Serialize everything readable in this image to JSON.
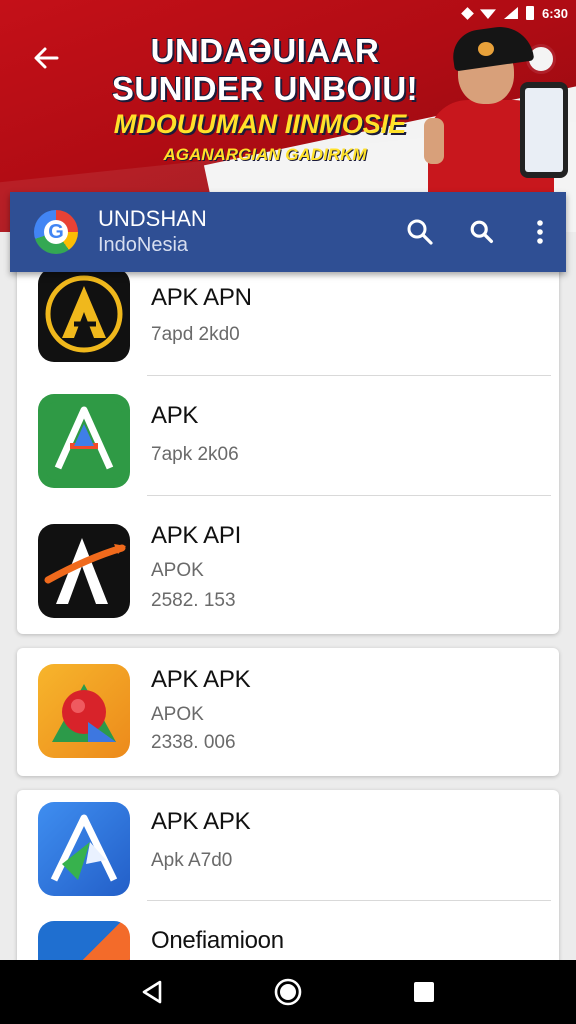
{
  "status_bar": {
    "time": "6:30",
    "icons": [
      "diamond-icon",
      "wifi-icon",
      "signal-icon",
      "battery-icon"
    ]
  },
  "banner": {
    "line1": "UNDAƏUIAAR",
    "line2": "SUNIDER UNBOIU!",
    "line3": "MDOUUMAN IINMOSIE",
    "line4": "AGANARGIAN GADIRKM",
    "back_icon": "arrow-left-icon"
  },
  "app_bar": {
    "title": "UNDSHAN",
    "subtitle": "IndoNesia",
    "icons": [
      "search-icon",
      "search-icon",
      "more-vert-icon"
    ],
    "color": "#2f4f94"
  },
  "apps": [
    {
      "name": "APK APN",
      "meta1": "7apd 2kd0",
      "meta2": "",
      "icon": "apk-a-logo-black"
    },
    {
      "name": "APK",
      "meta1": "7apk 2k06",
      "meta2": "",
      "icon": "apk-a-logo-green"
    },
    {
      "name": "APK API",
      "meta1": "APOK",
      "meta2": "2582. 153",
      "icon": "apk-a-swoosh-black"
    },
    {
      "name": "APK APK",
      "meta1": "APOK",
      "meta2": "2338. 006",
      "icon": "apk-ball-orange"
    },
    {
      "name": "APK APK",
      "meta1": "Apk A7d0",
      "meta2": "",
      "icon": "apk-a-logo-blue"
    },
    {
      "name": "Onefiamioon",
      "meta1": "",
      "meta2": "",
      "icon": "apk-gradient-logo"
    }
  ],
  "nav_bar": {
    "icons": [
      "back-triangle-icon",
      "home-circle-icon",
      "recents-square-icon"
    ]
  }
}
